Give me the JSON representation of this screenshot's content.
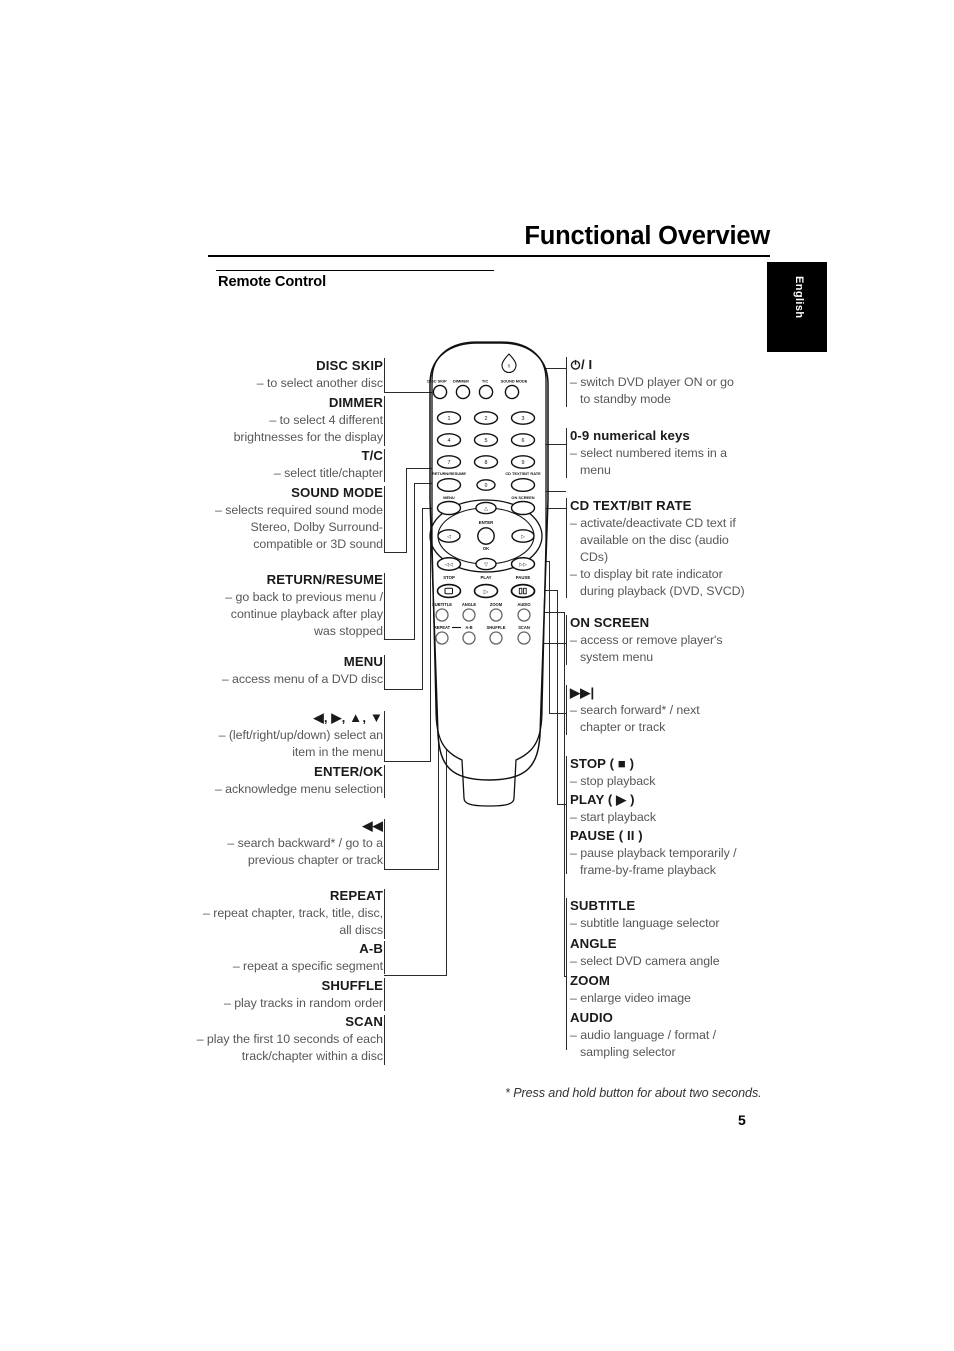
{
  "header": {
    "title": "Functional Overview",
    "section": "Remote Control",
    "language_tab": "English"
  },
  "footnote": "* Press and hold button for about two seconds.",
  "page_number": "5",
  "colors": {
    "text": "#1a1a1a",
    "description": "#575757",
    "rule": "#000000",
    "leader": "#2b2b2b",
    "tab_bg": "#000000",
    "tab_text": "#ffffff"
  },
  "left_callouts": [
    {
      "name": "DISC SKIP",
      "lines": [
        "– to select another disc"
      ]
    },
    {
      "name": "DIMMER",
      "lines": [
        "– to select 4 different",
        "brightnesses for the display"
      ]
    },
    {
      "name": "T/C",
      "lines": [
        "– select title/chapter"
      ]
    },
    {
      "name": "SOUND MODE",
      "lines": [
        "– selects required sound mode",
        "Stereo, Dolby Surround-",
        "compatible or 3D sound"
      ]
    },
    {
      "name": "RETURN/RESUME",
      "lines": [
        "– go back to previous menu /",
        "continue playback after play",
        "was stopped"
      ]
    },
    {
      "name": "MENU",
      "lines": [
        "– access menu of a DVD disc"
      ]
    },
    {
      "name": "◀, ▶, ▲, ▼",
      "lines": [
        "– (left/right/up/down) select an",
        "item in the menu"
      ]
    },
    {
      "name": "ENTER/OK",
      "lines": [
        "– acknowledge menu selection"
      ]
    },
    {
      "name": "◀◀",
      "lines": [
        "– search backward* / go to a",
        "previous chapter or track"
      ]
    },
    {
      "name": "REPEAT",
      "lines": [
        "– repeat chapter, track, title, disc,",
        "all discs"
      ]
    },
    {
      "name": "A-B",
      "lines": [
        "– repeat a specific segment"
      ]
    },
    {
      "name": "SHUFFLE",
      "lines": [
        "– play tracks in random order"
      ]
    },
    {
      "name": "SCAN",
      "lines": [
        "– play the first 10 seconds of each",
        "track/chapter within a disc"
      ]
    }
  ],
  "right_callouts": [
    {
      "name": "/ I",
      "icon": "power-icon",
      "lines": [
        "– switch DVD player ON or go",
        "to standby mode"
      ]
    },
    {
      "name": "0-9 numerical keys",
      "lines": [
        "– select numbered items in a",
        "menu"
      ]
    },
    {
      "name": "CD TEXT/BIT RATE",
      "lines": [
        "– activate/deactivate CD text if",
        "available on the disc (audio",
        "CDs)",
        "– to display bit rate indicator",
        "during playback (DVD, SVCD)"
      ]
    },
    {
      "name": "ON SCREEN",
      "lines": [
        "– access or remove player's",
        "system menu"
      ]
    },
    {
      "name": "▶▶|",
      "lines": [
        "– search forward* / next",
        "chapter or track"
      ]
    },
    {
      "name": "STOP ( ■ )",
      "lines": [
        "– stop playback"
      ]
    },
    {
      "name": "PLAY ( ▶ )",
      "lines": [
        "– start playback"
      ]
    },
    {
      "name": "PAUSE ( II )",
      "lines": [
        "– pause playback temporarily /",
        "frame-by-frame playback"
      ]
    },
    {
      "name": "SUBTITLE",
      "lines": [
        "– subtitle language selector"
      ]
    },
    {
      "name": "ANGLE",
      "lines": [
        "– select DVD camera angle"
      ]
    },
    {
      "name": "ZOOM",
      "lines": [
        "– enlarge video image"
      ]
    },
    {
      "name": "AUDIO",
      "lines": [
        "– audio language / format /",
        "sampling selector"
      ]
    }
  ],
  "remote": {
    "row_labels_top": [
      "DISC SKIP",
      "DIMMER",
      "T/C",
      "SOUND MODE"
    ],
    "numeric_keys": [
      "1",
      "2",
      "3",
      "4",
      "5",
      "6",
      "7",
      "8",
      "9",
      "0"
    ],
    "label_return_resume": "RETURN/RESUME",
    "label_cd_text": "CD TEXT/BIT RATE",
    "label_menu": "MENU",
    "label_on_screen": "ON SCREEN",
    "label_enter": "ENTER",
    "label_ok": "OK",
    "label_stop": "STOP",
    "label_play": "PLAY",
    "label_pause": "PAUSE",
    "row_labels_av": [
      "SUBTITLE",
      "ANGLE",
      "ZOOM",
      "AUDIO"
    ],
    "row_labels_mode": [
      "REPEAT",
      "A-B",
      "SHUFFLE",
      "SCAN"
    ],
    "power_glyph": "/I"
  }
}
